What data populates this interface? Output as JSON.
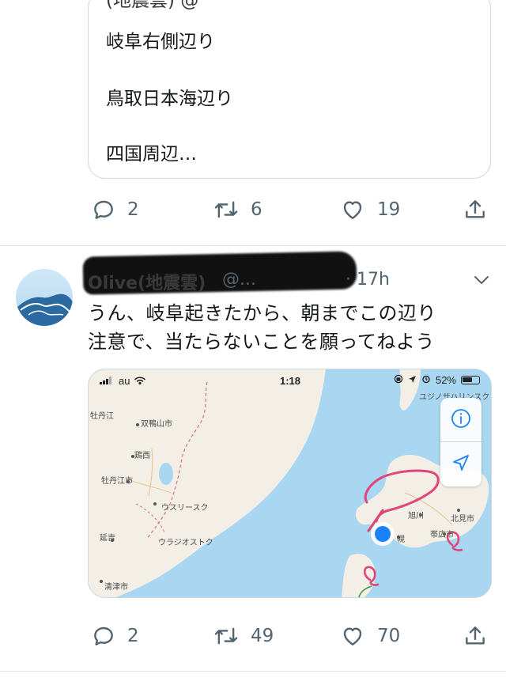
{
  "prev_tweet": {
    "quote_lines": [
      "岐阜右側辺り",
      "鳥取日本海辺り",
      "四国周辺…"
    ],
    "quote_cut_line": "(地震雲) @",
    "actions": {
      "reply_count": "2",
      "retweet_count": "6",
      "like_count": "19"
    }
  },
  "tweet": {
    "name": "Olive(地震雲)",
    "handle": "@...",
    "separator": "·",
    "time": "17h",
    "text_line1": "うん、岐阜起きたから、朝までこの辺り",
    "text_line2": "注意で、当たらないことを願ってねよう",
    "actions": {
      "reply_count": "2",
      "retweet_count": "49",
      "like_count": "70"
    }
  },
  "media": {
    "status_bar": {
      "carrier": "au",
      "time": "1:18",
      "battery": "52%"
    },
    "map_labels": {
      "mudanjiang_upper": "牡丹江",
      "shuangyashan": "双鴨山市",
      "jixi": "鶏西",
      "mudanjiang": "牡丹江市",
      "ussuriysk": "ウスリースク",
      "vladivostok": "ウラジオストク",
      "yanji": "延吉",
      "qingjin": "清津市",
      "asahikawa": "旭川",
      "kitami": "北見市",
      "obihiro": "帯広市",
      "sapporo": "幌",
      "yuzhno": "ユジノサハリンスク"
    },
    "colors": {
      "sea": "#a9d7f1",
      "land": "#f3efe6",
      "annotation": "#e0457b",
      "location": "#1a82fb"
    }
  },
  "icons": {
    "reply": "reply-icon",
    "retweet": "retweet-icon",
    "like": "heart-icon",
    "share": "share-icon",
    "chevron": "chevron-down-icon",
    "map_info": "info-icon",
    "map_locate": "location-arrow-icon"
  }
}
